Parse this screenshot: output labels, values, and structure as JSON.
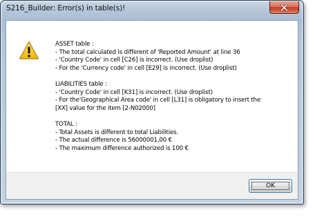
{
  "window": {
    "title": "S216_Builder: Error(s) in table(s)!",
    "close_icon": "close-icon"
  },
  "icon": "warning-icon",
  "colors": {
    "warning_fill": "#f5c518",
    "close_button": "#c4402a",
    "button_bar": "#f0f0f0",
    "focus_border": "#3c7fb1"
  },
  "message": {
    "asset": {
      "heading": "ASSET table :",
      "lines": [
        "- The total calculated is different of 'Reported Amount' at line 36",
        "- 'Country Code' in cell [C26] is incorrect. (Use droplist)",
        "- For the 'Currency code' in cell [E29] is incorrect. (Use droplist)"
      ]
    },
    "liabilities": {
      "heading": "LIABILITIES table :",
      "lines": [
        "- 'Country Code' in cell [K31] is incorrect. (Use droplist)",
        "- For the'Geographical Area code' in cell [L31] is obligatory to insert the",
        "[XX] value for the item [2-N02000]"
      ]
    },
    "total": {
      "heading": "TOTAL :",
      "lines": [
        "- Total Assets is different to total Liabilities.",
        "- The actual difference is 56000001,00 €",
        "- The maximum difference authorized is 100 €"
      ]
    }
  },
  "buttons": {
    "ok_label": "OK"
  }
}
